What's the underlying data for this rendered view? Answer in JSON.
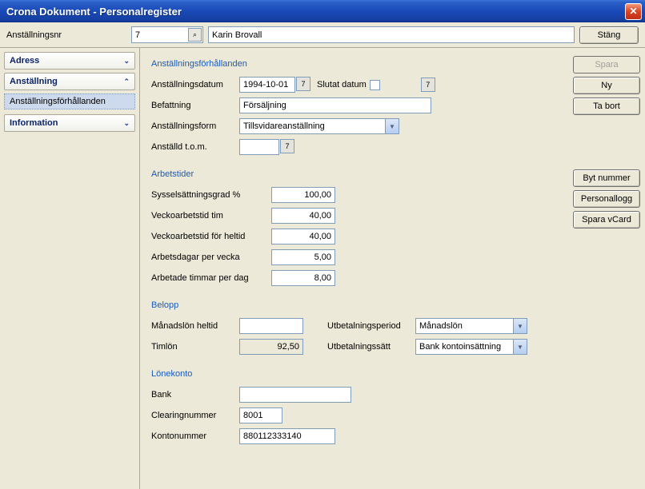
{
  "window": {
    "title": "Crona Dokument - Personalregister"
  },
  "top": {
    "label_nr": "Anställningsnr",
    "nr_value": "7",
    "name_value": "Karin Brovall",
    "close_label": "Stäng"
  },
  "sidebar": {
    "adress": "Adress",
    "anstallning": "Anställning",
    "anst_sub": "Anställningsförhållanden",
    "information": "Information"
  },
  "sections": {
    "anst": "Anställningsförhållanden",
    "arbet": "Arbetstider",
    "belopp": "Belopp",
    "lonekonto": "Lönekonto"
  },
  "anst": {
    "datum_lab": "Anställningsdatum",
    "datum_val": "1994-10-01",
    "slutat_lab": "Slutat datum",
    "befattning_lab": "Befattning",
    "befattning_val": "Försäljning",
    "form_lab": "Anställningsform",
    "form_val": "Tillsvidareanställning",
    "tom_lab": "Anställd t.o.m.",
    "tom_val": ""
  },
  "arbet": {
    "grad_lab": "Sysselsättningsgrad %",
    "grad_val": "100,00",
    "tim_lab": "Veckoarbetstid tim",
    "tim_val": "40,00",
    "heltid_lab": "Veckoarbetstid för heltid",
    "heltid_val": "40,00",
    "dagar_lab": "Arbetsdagar per vecka",
    "dagar_val": "5,00",
    "timdag_lab": "Arbetade timmar per dag",
    "timdag_val": "8,00"
  },
  "belopp": {
    "manads_lab": "Månadslön heltid",
    "manads_val": "",
    "timlon_lab": "Timlön",
    "timlon_val": "92,50",
    "period_lab": "Utbetalningsperiod",
    "period_val": "Månadslön",
    "satt_lab": "Utbetalningssätt",
    "satt_val": "Bank kontoinsättning"
  },
  "lonekonto": {
    "bank_lab": "Bank",
    "bank_val": "",
    "clearing_lab": "Clearingnummer",
    "clearing_val": "8001",
    "konto_lab": "Kontonummer",
    "konto_val": "880112333140"
  },
  "buttons": {
    "spara": "Spara",
    "ny": "Ny",
    "tabort": "Ta bort",
    "bytnummer": "Byt nummer",
    "personallogg": "Personallogg",
    "sparavcard": "Spara vCard"
  }
}
